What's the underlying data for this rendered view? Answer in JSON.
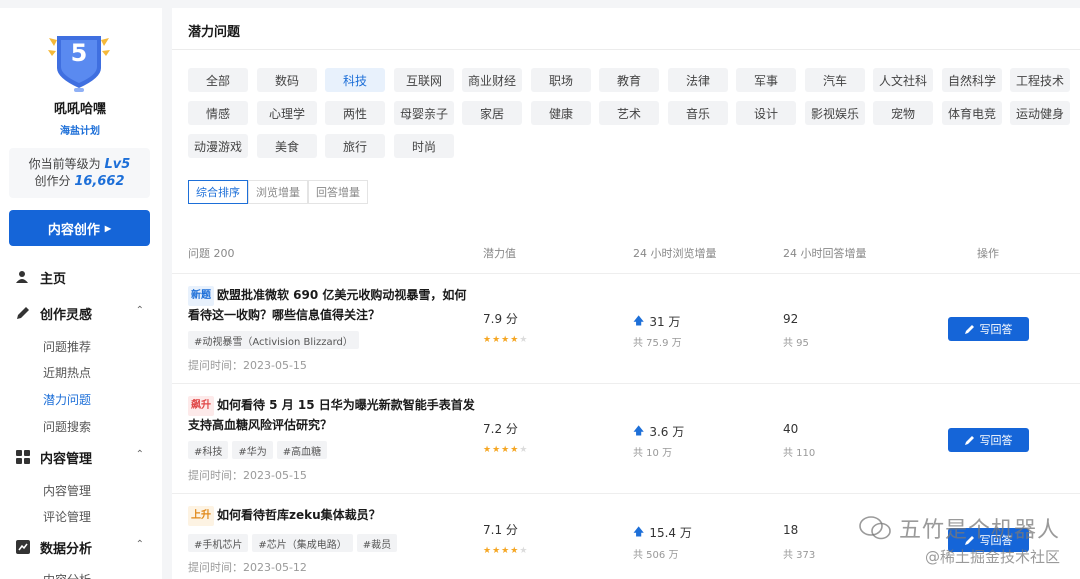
{
  "user": {
    "level_number": "5",
    "name": "吼吼哈嘿",
    "plan": "海盐计划",
    "level_text": "你当前等级为",
    "level": "Lv5",
    "score_label": "创作分",
    "score": "16,662"
  },
  "create_button": "内容创作",
  "nav": {
    "home": "主页",
    "inspiration": "创作灵感",
    "inspiration_items": [
      "问题推荐",
      "近期热点",
      "潜力问题",
      "问题搜索"
    ],
    "content": "内容管理",
    "content_items": [
      "内容管理",
      "评论管理"
    ],
    "analytics": "数据分析",
    "analytics_items": [
      "内容分析"
    ]
  },
  "page_title": "潜力问题",
  "categories": [
    [
      "全部",
      "数码",
      "科技",
      "互联网",
      "商业财经",
      "职场",
      "教育",
      "法律",
      "军事",
      "汽车",
      "人文社科",
      "自然科学",
      "工程技术"
    ],
    [
      "情感",
      "心理学",
      "两性",
      "母婴亲子",
      "家居",
      "健康",
      "艺术",
      "音乐",
      "设计",
      "影视娱乐",
      "宠物",
      "体育电竞",
      "运动健身"
    ],
    [
      "动漫游戏",
      "美食",
      "旅行",
      "时尚"
    ]
  ],
  "active_category": "科技",
  "sort_tabs": [
    "综合排序",
    "浏览增量",
    "回答增量"
  ],
  "table_headers": [
    "问题 200",
    "潜力值",
    "24 小时浏览增量",
    "24 小时回答增量",
    "操作"
  ],
  "rows": [
    {
      "badge": "新题",
      "title": "欧盟批准微软 690 亿美元收购动视暴雪，如何看待这一收购？哪些信息值得关注？",
      "tags": [
        "#动视暴雪（Activision Blizzard）"
      ],
      "date": "提问时间：2023-05-15",
      "potential": "7.9 分",
      "stars": 4,
      "views": "31 万",
      "views_total": "共 75.9 万",
      "answers": "92",
      "answers_total": "共 95",
      "button": "写回答"
    },
    {
      "badge": "飙升",
      "title": "如何看待 5 月 15 日华为曝光新款智能手表首发支持高血糖风险评估研究？",
      "tags": [
        "#科技",
        "#华为",
        "#高血糖"
      ],
      "date": "提问时间：2023-05-15",
      "potential": "7.2 分",
      "stars": 4,
      "views": "3.6 万",
      "views_total": "共 10 万",
      "answers": "40",
      "answers_total": "共 110",
      "button": "写回答"
    },
    {
      "badge": "上升",
      "title": "如何看待哲库zeku集体裁员？",
      "tags": [
        "#手机芯片",
        "#芯片（集成电路）",
        "#裁员"
      ],
      "date": "提问时间：2023-05-12",
      "potential": "7.1 分",
      "stars": 4,
      "views": "15.4 万",
      "views_total": "共 506 万",
      "answers": "18",
      "answers_total": "共 373",
      "button": "写回答"
    }
  ],
  "watermark": {
    "main": "五竹是个机器人",
    "sub": "@稀土掘金技术社区"
  },
  "colors": {
    "accent": "#1565d8",
    "link": "#1d6fd8",
    "star": "#f5a623",
    "badge_surge": "#e04848",
    "badge_up": "#e08a1c"
  }
}
